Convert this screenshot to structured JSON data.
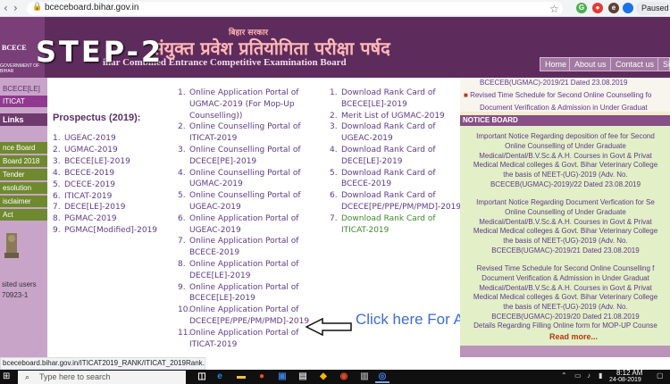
{
  "browser": {
    "url": "bceceboard.bihar.gov.in",
    "paused_label": "Paused",
    "status_url": "bceceboard.bihar.gov.in/ITICAT2019_RANK/ITICAT_2019Rank.php"
  },
  "header": {
    "step_label": "STEP-2",
    "bihar_sarkar": "बिहार सरकार",
    "hindi_title": "संयुक्त प्रवेश प्रतियोगिता परीक्षा पर्षद",
    "eng_title": "ihar Combined Entrance Competitive Examination Board",
    "logo_text": "BCECE",
    "logo_sub": "GOVERNMENT OF BIHAR",
    "nav": [
      "Home",
      "About us",
      "Contact us",
      "Si"
    ]
  },
  "sidebar": {
    "items": [
      "BCECE[LE]",
      "ITICAT",
      "Links",
      "nce Board",
      "Board 2018",
      "Tender",
      "esolution",
      "isclaimer",
      "Act"
    ],
    "visitor_label": "sited users",
    "visitor_count": "70923-1"
  },
  "prospectus": {
    "title": "Prospectus (2019):",
    "items": [
      {
        "num": "1.",
        "label": "UGEAC-2019"
      },
      {
        "num": "2.",
        "label": "UGMAC-2019"
      },
      {
        "num": "3.",
        "label": "BCECE[LE]-2019"
      },
      {
        "num": "4.",
        "label": "BCECE-2019"
      },
      {
        "num": "5.",
        "label": "DCECE-2019"
      },
      {
        "num": "6.",
        "label": "ITICAT-2019"
      },
      {
        "num": "7.",
        "label": "DECE[LE]-2019"
      },
      {
        "num": "8.",
        "label": "PGMAC-2019"
      },
      {
        "num": "9.",
        "label": "PGMAC[Modified]-2019"
      }
    ]
  },
  "portals": {
    "lines": [
      {
        "num": "1.",
        "text": "Online Application Portal of"
      },
      {
        "num": "",
        "text": "UGMAC-2019 (For Mop-Up"
      },
      {
        "num": "",
        "text": "Counselling))"
      },
      {
        "num": "2.",
        "text": "Online Counselling Portal of"
      },
      {
        "num": "",
        "text": "ITICAT-2019"
      },
      {
        "num": "3.",
        "text": "Online Counselling Portal of"
      },
      {
        "num": "",
        "text": "DCECE[PE]-2019"
      },
      {
        "num": "4.",
        "text": "Online Counselling Portal of"
      },
      {
        "num": "",
        "text": "UGMAC-2019"
      },
      {
        "num": "5.",
        "text": "Online Counselling Portal of"
      },
      {
        "num": "",
        "text": "UGEAC-2019"
      },
      {
        "num": "6.",
        "text": "Online Application Portal of"
      },
      {
        "num": "",
        "text": "UGEAC-2019"
      },
      {
        "num": "7.",
        "text": "Online Application Portal of"
      },
      {
        "num": "",
        "text": "BCECE-2019"
      },
      {
        "num": "8.",
        "text": "Online Application Portal of"
      },
      {
        "num": "",
        "text": "DECE[LE]-2019"
      },
      {
        "num": "9.",
        "text": "Online Application Portal of"
      },
      {
        "num": "",
        "text": "BCECE[LE]-2019"
      },
      {
        "num": "10.",
        "text": "Online Application Portal of"
      },
      {
        "num": "",
        "text": "DCECE[PE/PPE/PM/PMD]-2019"
      },
      {
        "num": "11.",
        "text": "Online Application Portal of"
      },
      {
        "num": "",
        "text": "ITICAT-2019"
      }
    ]
  },
  "ranks": {
    "lines": [
      {
        "num": "1.",
        "text": "Download Rank Card of",
        "green": false
      },
      {
        "num": "",
        "text": "BCECE[LE]-2019",
        "green": false
      },
      {
        "num": "2.",
        "text": "Merit List of UGMAC-2019",
        "green": false
      },
      {
        "num": "3.",
        "text": "Download Rank Card of",
        "green": false
      },
      {
        "num": "",
        "text": "UGEAC-2019",
        "green": false
      },
      {
        "num": "4.",
        "text": "Download Rank Card of",
        "green": false
      },
      {
        "num": "",
        "text": "DECE[LE]-2019",
        "green": false
      },
      {
        "num": "5.",
        "text": "Download Rank Card of",
        "green": false
      },
      {
        "num": "",
        "text": "BCECE-2019",
        "green": false
      },
      {
        "num": "6.",
        "text": "Download Rank Card of",
        "green": false
      },
      {
        "num": "",
        "text": "DCECE[PE/PPE/PM/PMD]-2019",
        "green": false
      },
      {
        "num": "7.",
        "text": "Download Rank Card of",
        "green": true
      },
      {
        "num": "",
        "text": "ITICAT-2019",
        "green": true
      }
    ]
  },
  "annotation": {
    "click_text": "Click here For Apply online"
  },
  "right_panel": {
    "scroll_items": [
      "BCECEB(UGMAC)-2019/21 Dated 23.08.2019",
      "Revised Time Schedule for Second Online Counselling fo",
      "Document Verification & Admission in Under Graduat"
    ],
    "notice_board_title": "NOTICE BOARD",
    "notices": [
      [
        "Important Notice Regarding deposition of fee for Second",
        "Online Counselling of Under Graduate",
        "Medical/Dental/B.V.Sc.& A.H. Courses in Govt & Privat",
        "Medical Medical colleges & Govt. Bihar Veterinary College",
        "the basis of NEET-(UG)-2019 (Adv. No.",
        "BCECEB(UGMAC)-2019)/22 Dated 23.08.2019"
      ],
      [
        "Important Notice Regarding Document Verfication for Se",
        "Online Counselling of Under Graduate",
        "Medical/Dental/B.V.Sc.& A.H. Courses in Govt & Privat",
        "Medical Medical colleges & Govt. Bihar Veterinary College",
        "the basis of NEET-(UG)-2019 (Adv. No.",
        "BCECEB(UGMAC)-2019/21 Dated 23.08.2019"
      ],
      [
        "Revised Time Schedule for Second Online Counselling f",
        "Document Verification & Admission in Under Graduat",
        "Medical/Dental/B.V.Sc.& A.H. Courses in Govt & Privat",
        "Medical Medical colleges & Govt. Bihar Veterinary College",
        "the basis of NEET-(UG)-2019 (Adv. No.",
        "BCECEB(UGMAC)-2019/20 Dated 21.08.2019"
      ],
      [
        "Details Regarding Filling Online form for MOP-UP Counse"
      ]
    ],
    "read_more": "Read more..."
  },
  "taskbar": {
    "search_placeholder": "Type here to search",
    "time": "8:12 AM",
    "date": "24-08-2019"
  },
  "colors": {
    "header_bg": "#5d2c5c",
    "link": "#5e3a8a",
    "notice_bg": "#e3efc7",
    "click_text": "#3b6ddb"
  }
}
